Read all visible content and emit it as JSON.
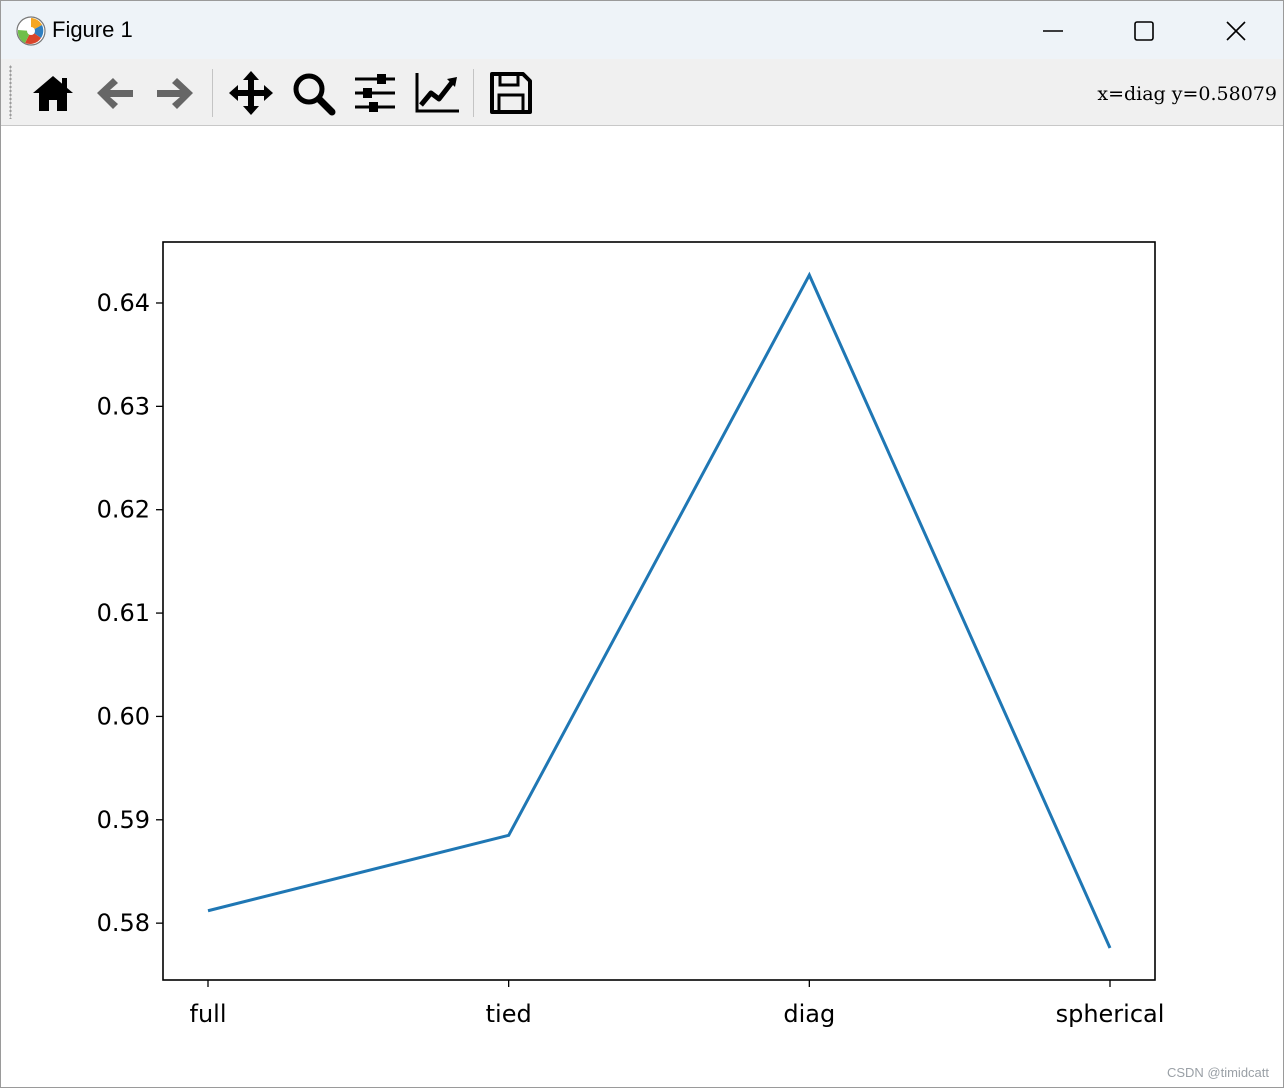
{
  "window": {
    "title": "Figure 1",
    "controls": [
      "minimize-icon",
      "maximize-icon",
      "close-icon"
    ]
  },
  "toolbar": {
    "buttons": [
      "home-icon",
      "back-icon",
      "forward-icon",
      "pan-icon",
      "zoom-icon",
      "configure-subplots-icon",
      "edit-axis-icon",
      "save-icon"
    ],
    "coordinate_readout": "x=diag y=0.58079"
  },
  "chart_data": {
    "type": "line",
    "categories": [
      "full",
      "tied",
      "diag",
      "spherical"
    ],
    "series": [
      {
        "values": [
          0.5812,
          0.5885,
          0.6427,
          0.5776
        ],
        "color": "#1f77b4"
      }
    ],
    "ylim": [
      0.5745,
      0.6459
    ],
    "yticks": [
      0.58,
      0.59,
      0.6,
      0.61,
      0.62,
      0.63,
      0.64
    ],
    "ytick_labels": [
      "0.58",
      "0.59",
      "0.60",
      "0.61",
      "0.62",
      "0.63",
      "0.64"
    ],
    "grid": false,
    "title": "",
    "xlabel": "",
    "ylabel": ""
  },
  "watermark": "CSDN @timidcatt"
}
